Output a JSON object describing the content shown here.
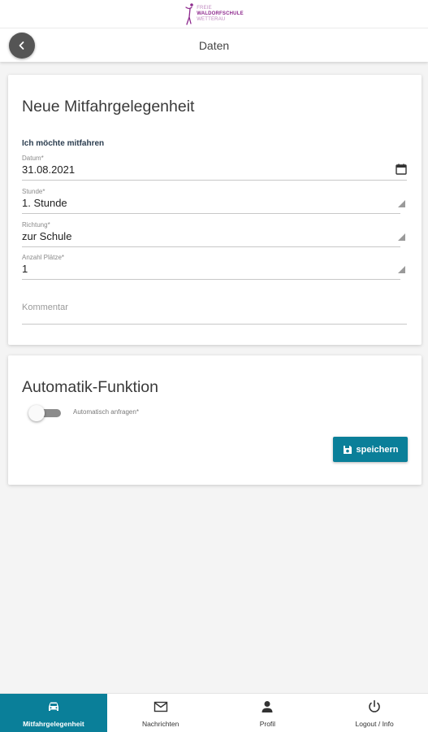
{
  "logo": {
    "line1": "FREIE",
    "line2": "WALDORFSCHULE",
    "line3": "WETTERAU"
  },
  "header": {
    "title": "Daten"
  },
  "ride_form": {
    "title": "Neue Mitfahrgelegenheit",
    "subtitle": "Ich möchte mitfahren",
    "fields": {
      "date": {
        "label": "Datum*",
        "value": "31.08.2021"
      },
      "lesson": {
        "label": "Stunde*",
        "value": "1. Stunde"
      },
      "direction": {
        "label": "Richtung*",
        "value": "zur Schule"
      },
      "seats": {
        "label": "Anzahl Plätze*",
        "value": "1"
      },
      "comment": {
        "label": "Kommentar",
        "value": ""
      }
    }
  },
  "automatic": {
    "title": "Automatik-Funktion",
    "toggle_label": "Automatisch anfragen*",
    "toggle_on": false,
    "save_label": "speichern"
  },
  "bottom_nav": {
    "items": [
      {
        "label": "Mitfahrgelegenheit",
        "icon": "car-icon",
        "active": true
      },
      {
        "label": "Nachrichten",
        "icon": "mail-icon",
        "active": false
      },
      {
        "label": "Profil",
        "icon": "person-icon",
        "active": false
      },
      {
        "label": "Logout / Info",
        "icon": "power-icon",
        "active": false
      }
    ]
  },
  "colors": {
    "accent": "#0a7f99",
    "brand": "#8e2a8e",
    "back_button": "#555555"
  }
}
